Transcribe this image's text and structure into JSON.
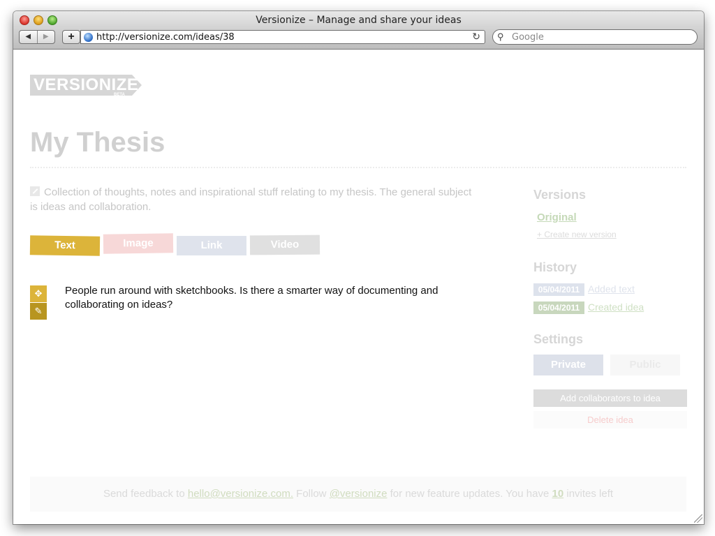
{
  "window": {
    "title": "Versionize – Manage and share your ideas",
    "back_glyph": "◀",
    "forward_glyph": "▶",
    "plus_glyph": "+",
    "url": "http://versionize.com/ideas/38",
    "reload_glyph": "↻",
    "search_placeholder": "Google",
    "search_glyph": "⚲"
  },
  "logo": {
    "text": "VERSIONIZE",
    "badge": "BETA",
    "color": "#d6d6d6"
  },
  "page": {
    "title": "My Thesis",
    "description": "Collection of thoughts, notes and inspirational stuff relating to my thesis. The general subject is ideas and collaboration."
  },
  "tabs": [
    {
      "label": "Text",
      "color": "#dcb43a"
    },
    {
      "label": "Image",
      "color": "#f7d8d8"
    },
    {
      "label": "Link",
      "color": "#dfe3ec"
    },
    {
      "label": "Video",
      "color": "#e0e0e0"
    }
  ],
  "item": {
    "text": "People run around with sketchbooks. Is there a smarter way of documenting and collaborating on ideas?",
    "move_glyph": "✥",
    "edit_glyph": "✎"
  },
  "sidebar": {
    "versions_heading": "Versions",
    "original_link": "Original",
    "create_link": "+ Create new version",
    "history_heading": "History",
    "history": [
      {
        "date": "05/04/2011",
        "action": "Added text"
      },
      {
        "date": "05/04/2011",
        "action": "Created idea"
      }
    ],
    "settings_heading": "Settings",
    "private_label": "Private",
    "public_label": "Public",
    "collab_label": "Add collaborators to idea",
    "delete_label": "Delete idea"
  },
  "footer": {
    "prefix": "Send feedback to",
    "email": "hello@versionize.com.",
    "follow": "Follow",
    "twitter": "@versionize",
    "middle": "for new feature updates. You have",
    "invites": "10",
    "suffix": "invites left"
  }
}
